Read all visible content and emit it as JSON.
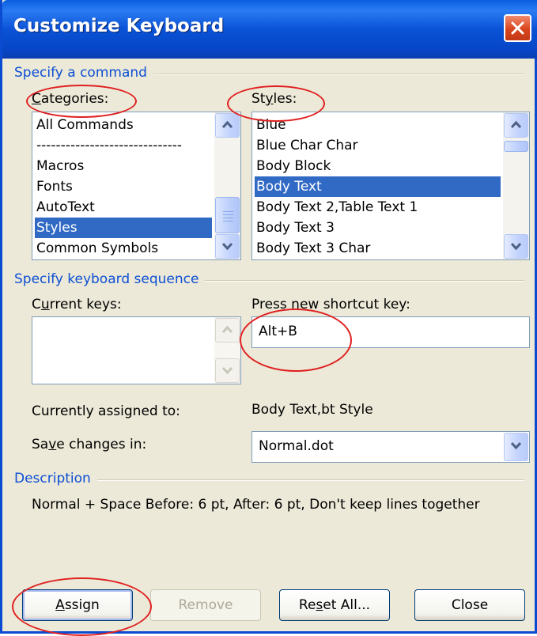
{
  "window": {
    "title": "Customize Keyboard"
  },
  "command_section": {
    "heading": "Specify a command",
    "categories_label": "Categories:",
    "categories_items": [
      "All Commands",
      "------------------------------",
      "Macros",
      "Fonts",
      "AutoText",
      "Styles",
      "Common Symbols"
    ],
    "categories_selected": "Styles",
    "styles_label": "Styles:",
    "styles_items": [
      "Blue",
      "Blue Char Char",
      "Body Block",
      "Body Text",
      "Body Text 2,Table Text 1",
      "Body Text 3",
      "Body Text 3 Char"
    ],
    "styles_selected": "Body Text"
  },
  "keyboard_section": {
    "heading": "Specify keyboard sequence",
    "current_keys_label": "Current keys:",
    "new_shortcut_label": "Press new shortcut key:",
    "new_shortcut_value": "Alt+B",
    "assigned_to_label": "Currently assigned to:",
    "assigned_to_value": "Body Text,bt Style",
    "save_in_label": "Save changes in:",
    "save_in_value": "Normal.dot"
  },
  "description_section": {
    "heading": "Description",
    "text": "Normal + Space Before:  6 pt, After:  6 pt, Don't keep lines together"
  },
  "buttons": {
    "assign": "Assign",
    "remove": "Remove",
    "reset_all": "Reset All...",
    "close": "Close"
  },
  "colors": {
    "titlebar": "#0a52d6",
    "selection": "#316ac5",
    "section_heading": "#0d4fd4",
    "annotation": "#e02020"
  }
}
